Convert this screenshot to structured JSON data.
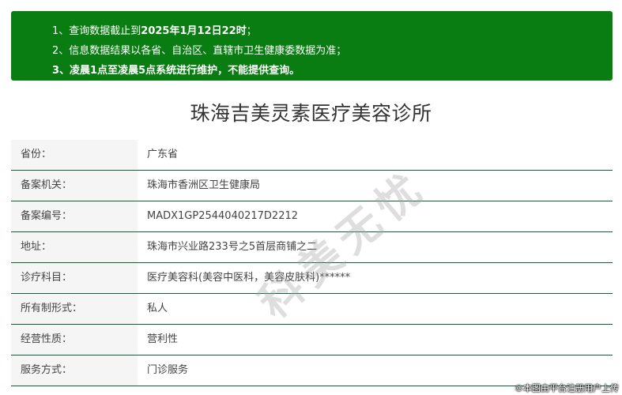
{
  "notice": {
    "line1_prefix": "1、查询数据截止到",
    "line1_bold": "2025年1月12日22时",
    "line1_suffix": "；",
    "line2": "2、信息数据结果以各省、自治区、直辖市卫生健康委数据为准；",
    "line3_prefix": "3、",
    "line3_bold": "凌晨1点至凌晨5点",
    "line3_suffix": "系统进行维护，不能提供查询。",
    "background": "#0a7d12"
  },
  "title": "珠海吉美灵素医疗美容诊所",
  "rows": [
    {
      "label": "省份：",
      "value": "广东省"
    },
    {
      "label": "备案机关：",
      "value": "珠海市香洲区卫生健康局"
    },
    {
      "label": "备案编号：",
      "value": "MADX1GP2544040217D2212"
    },
    {
      "label": "地址：",
      "value": "珠海市兴业路233号之5首层商铺之二"
    },
    {
      "label": "诊疗科目：",
      "value": "医疗美容科(美容中医科，美容皮肤科)******"
    },
    {
      "label": "所有制形式：",
      "value": "私人"
    },
    {
      "label": "经营性质：",
      "value": "营利性"
    },
    {
      "label": "服务方式：",
      "value": "门诊服务"
    }
  ],
  "watermark": "科美无忧",
  "copyright": "©本图由平台注册用户上传"
}
